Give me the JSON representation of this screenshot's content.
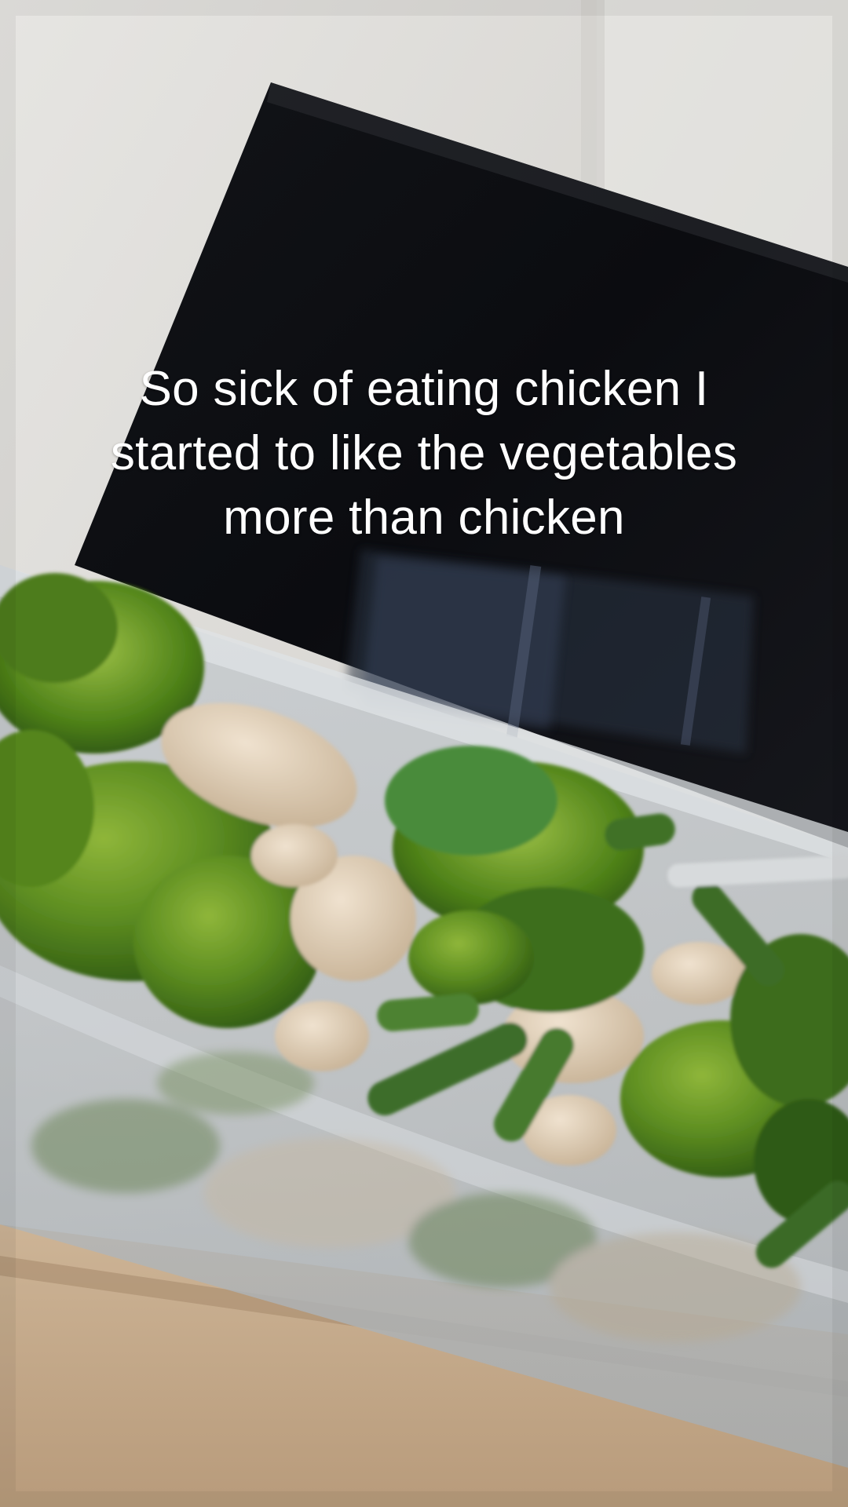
{
  "photo": {
    "subject": "meal-prep-container",
    "caption_lines": [
      "So sick of eating chicken I",
      "started to like the vegetables",
      "more than chicken"
    ]
  }
}
